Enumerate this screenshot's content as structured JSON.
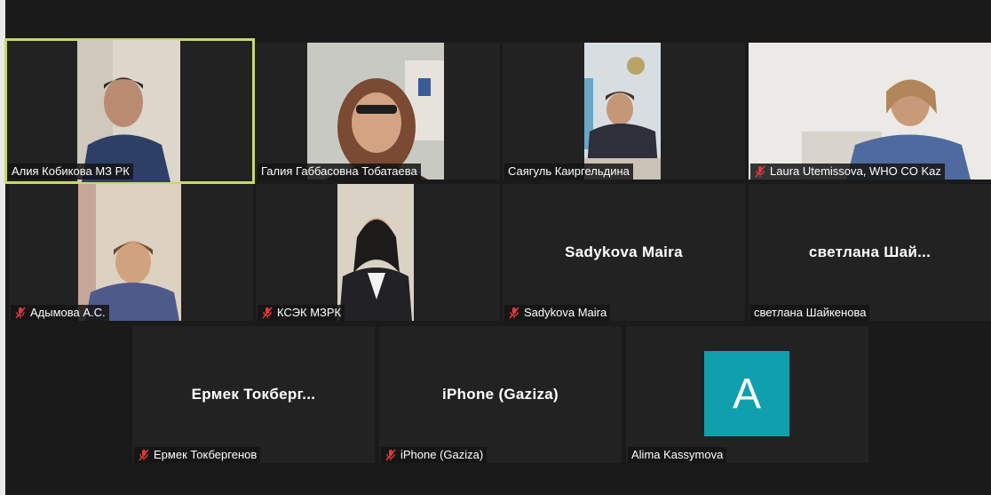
{
  "participants": [
    {
      "name": "Алия Кобикова МЗ РК",
      "muted": false,
      "video": true,
      "active": true
    },
    {
      "name": "Галия Габбасовна Тобатаева",
      "muted": false,
      "video": true,
      "active": false
    },
    {
      "name": "Саягуль Каиргельдина",
      "muted": false,
      "video": true,
      "active": false
    },
    {
      "name": "Laura Utemissova, WHO CO Kaz",
      "muted": true,
      "video": true,
      "active": false
    },
    {
      "name": "Адымова А.С.",
      "muted": true,
      "video": true,
      "active": false
    },
    {
      "name": "КСЭК МЗРК",
      "muted": true,
      "video": true,
      "active": false
    },
    {
      "name": "Sadykova Maira",
      "display_name": "Sadykova Maira",
      "muted": true,
      "video": false,
      "active": false
    },
    {
      "name": "светлана Шайкенова",
      "display_name": "светлана  Шай...",
      "muted": false,
      "video": false,
      "active": false
    },
    {
      "name": "Ермек Токбергенов",
      "display_name": "Ермек  Токберг...",
      "muted": true,
      "video": false,
      "active": false
    },
    {
      "name": "iPhone (Gaziza)",
      "display_name": "iPhone (Gaziza)",
      "muted": true,
      "video": false,
      "active": false
    },
    {
      "name": "Alima Kassymova",
      "avatar_letter": "A",
      "muted": false,
      "video": false,
      "active": false
    }
  ],
  "colors": {
    "active_border": "#c6d96a",
    "muted_icon": "#e0393e",
    "avatar_bg": "#10a0ad",
    "tile_bg": "#222222",
    "page_bg": "#1a1a1a"
  },
  "icons": {
    "muted": "mic-off-icon"
  }
}
